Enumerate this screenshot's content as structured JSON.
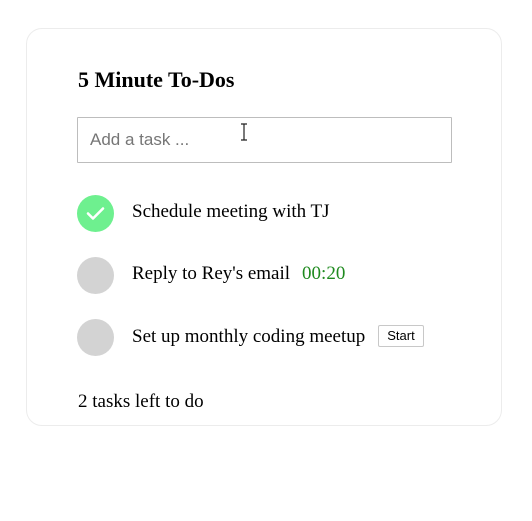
{
  "app": {
    "title": "5 Minute To-Dos"
  },
  "new_task": {
    "placeholder": "Add a task ...",
    "value": ""
  },
  "tasks": [
    {
      "text": "Schedule meeting with TJ",
      "status": "completed",
      "check_icon": "checkmark-icon",
      "timer": "",
      "action_label": ""
    },
    {
      "text": "Reply to Rey's email",
      "status": "in-progress",
      "timer": "00:20",
      "action_label": ""
    },
    {
      "text": "Set up monthly coding meetup",
      "status": "pending",
      "timer": "",
      "action_label": "Start"
    }
  ],
  "footer": {
    "remaining_text": "2 tasks left to do"
  },
  "colors": {
    "completed_check": "#6ef08f",
    "pending_check": "#d3d3d3",
    "timer": "#1e8a1e"
  }
}
